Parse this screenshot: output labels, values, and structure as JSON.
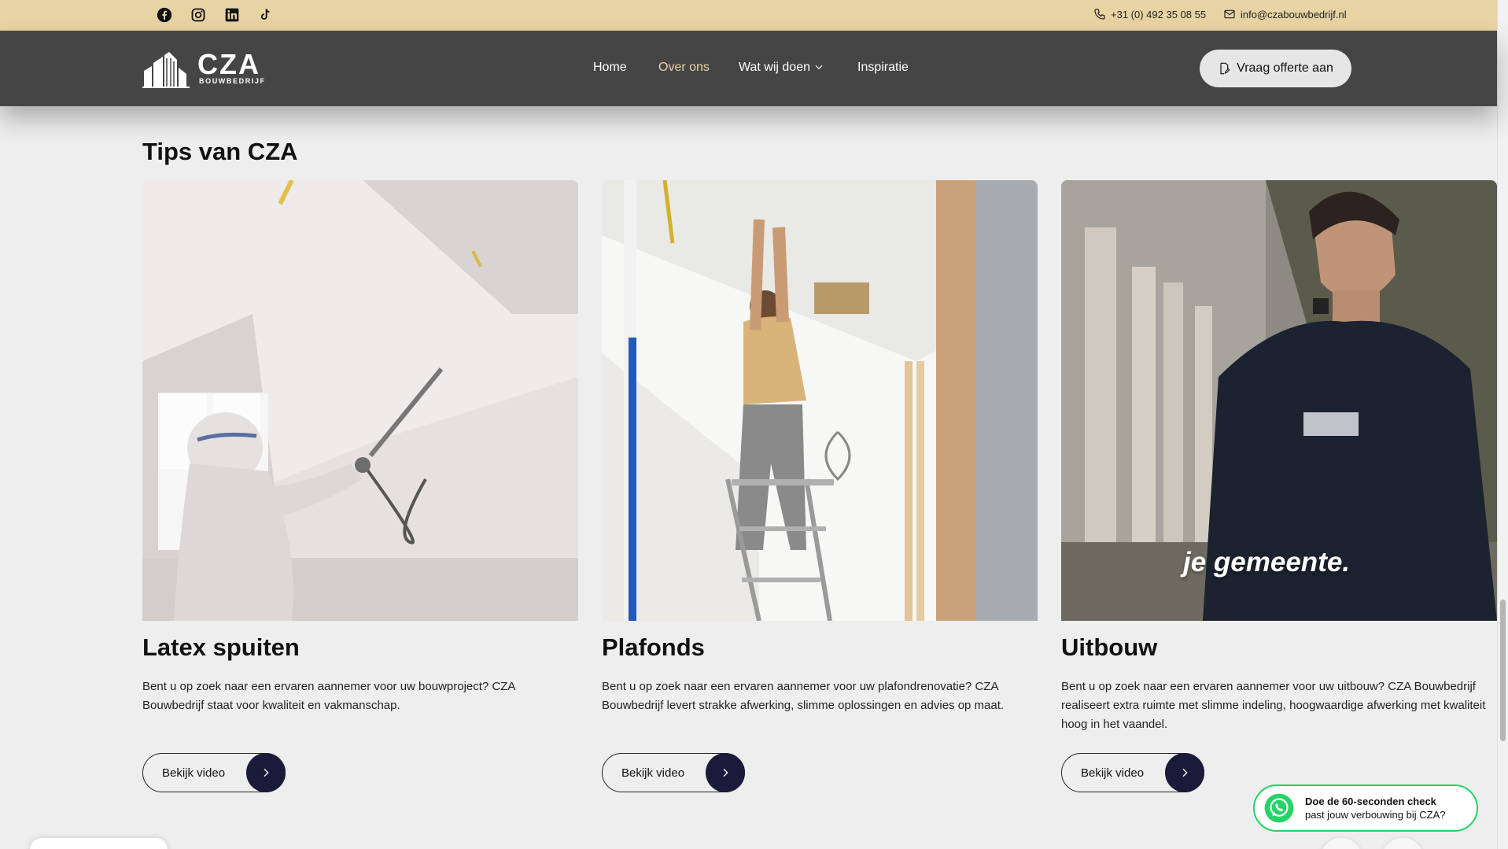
{
  "topbar": {
    "social": [
      "facebook-icon",
      "instagram-icon",
      "linkedin-icon",
      "tiktok-icon"
    ],
    "phone": "+31 (0) 492 35 08 55",
    "email": "info@czabouwbedrijf.nl"
  },
  "nav": {
    "logo_word": "CZA",
    "logo_sub": "BOUWBEDRIJF",
    "items": [
      {
        "label": "Home",
        "active": false
      },
      {
        "label": "Over ons",
        "active": true
      },
      {
        "label": "Wat wij doen",
        "active": false,
        "dropdown": true
      },
      {
        "label": "Inspiratie",
        "active": false
      }
    ],
    "cta": "Vraag offerte aan"
  },
  "section": {
    "title": "Tips van CZA",
    "cards": [
      {
        "title": "Latex spuiten",
        "text": "Bent u op zoek naar een ervaren aannemer voor uw bouwproject? CZA Bouwbedrijf staat voor kwaliteit en vakmanschap.",
        "button": "Bekijk video",
        "image": "painter-spraying-latex"
      },
      {
        "title": "Plafonds",
        "text": "Bent u op zoek naar een ervaren aannemer voor uw plafondrenovatie? CZA Bouwbedrijf levert strakke afwerking, slimme oplossingen en advies op maat.",
        "button": "Bekijk video",
        "image": "worker-on-ladder-ceiling"
      },
      {
        "title": "Uitbouw",
        "text": "Bent u op zoek naar een ervaren aannemer voor uw uitbouw? CZA Bouwbedrijf realiseert extra ruimte met slimme indeling, hoogwaardige afwerking met kwaliteit hoog in het vaandel.",
        "button": "Bekijk video",
        "image": "man-in-garden",
        "overlay": "je gemeente."
      }
    ]
  },
  "whatsapp": {
    "line1": "Doe de 60-seconden check",
    "line2": "past jouw verbouwing bij CZA?"
  },
  "colors": {
    "topbar": "#e8d4a3",
    "nav": "#454545",
    "accent": "#e8d4a3",
    "button_dark": "#1a1a3a",
    "whatsapp": "#25d366"
  }
}
